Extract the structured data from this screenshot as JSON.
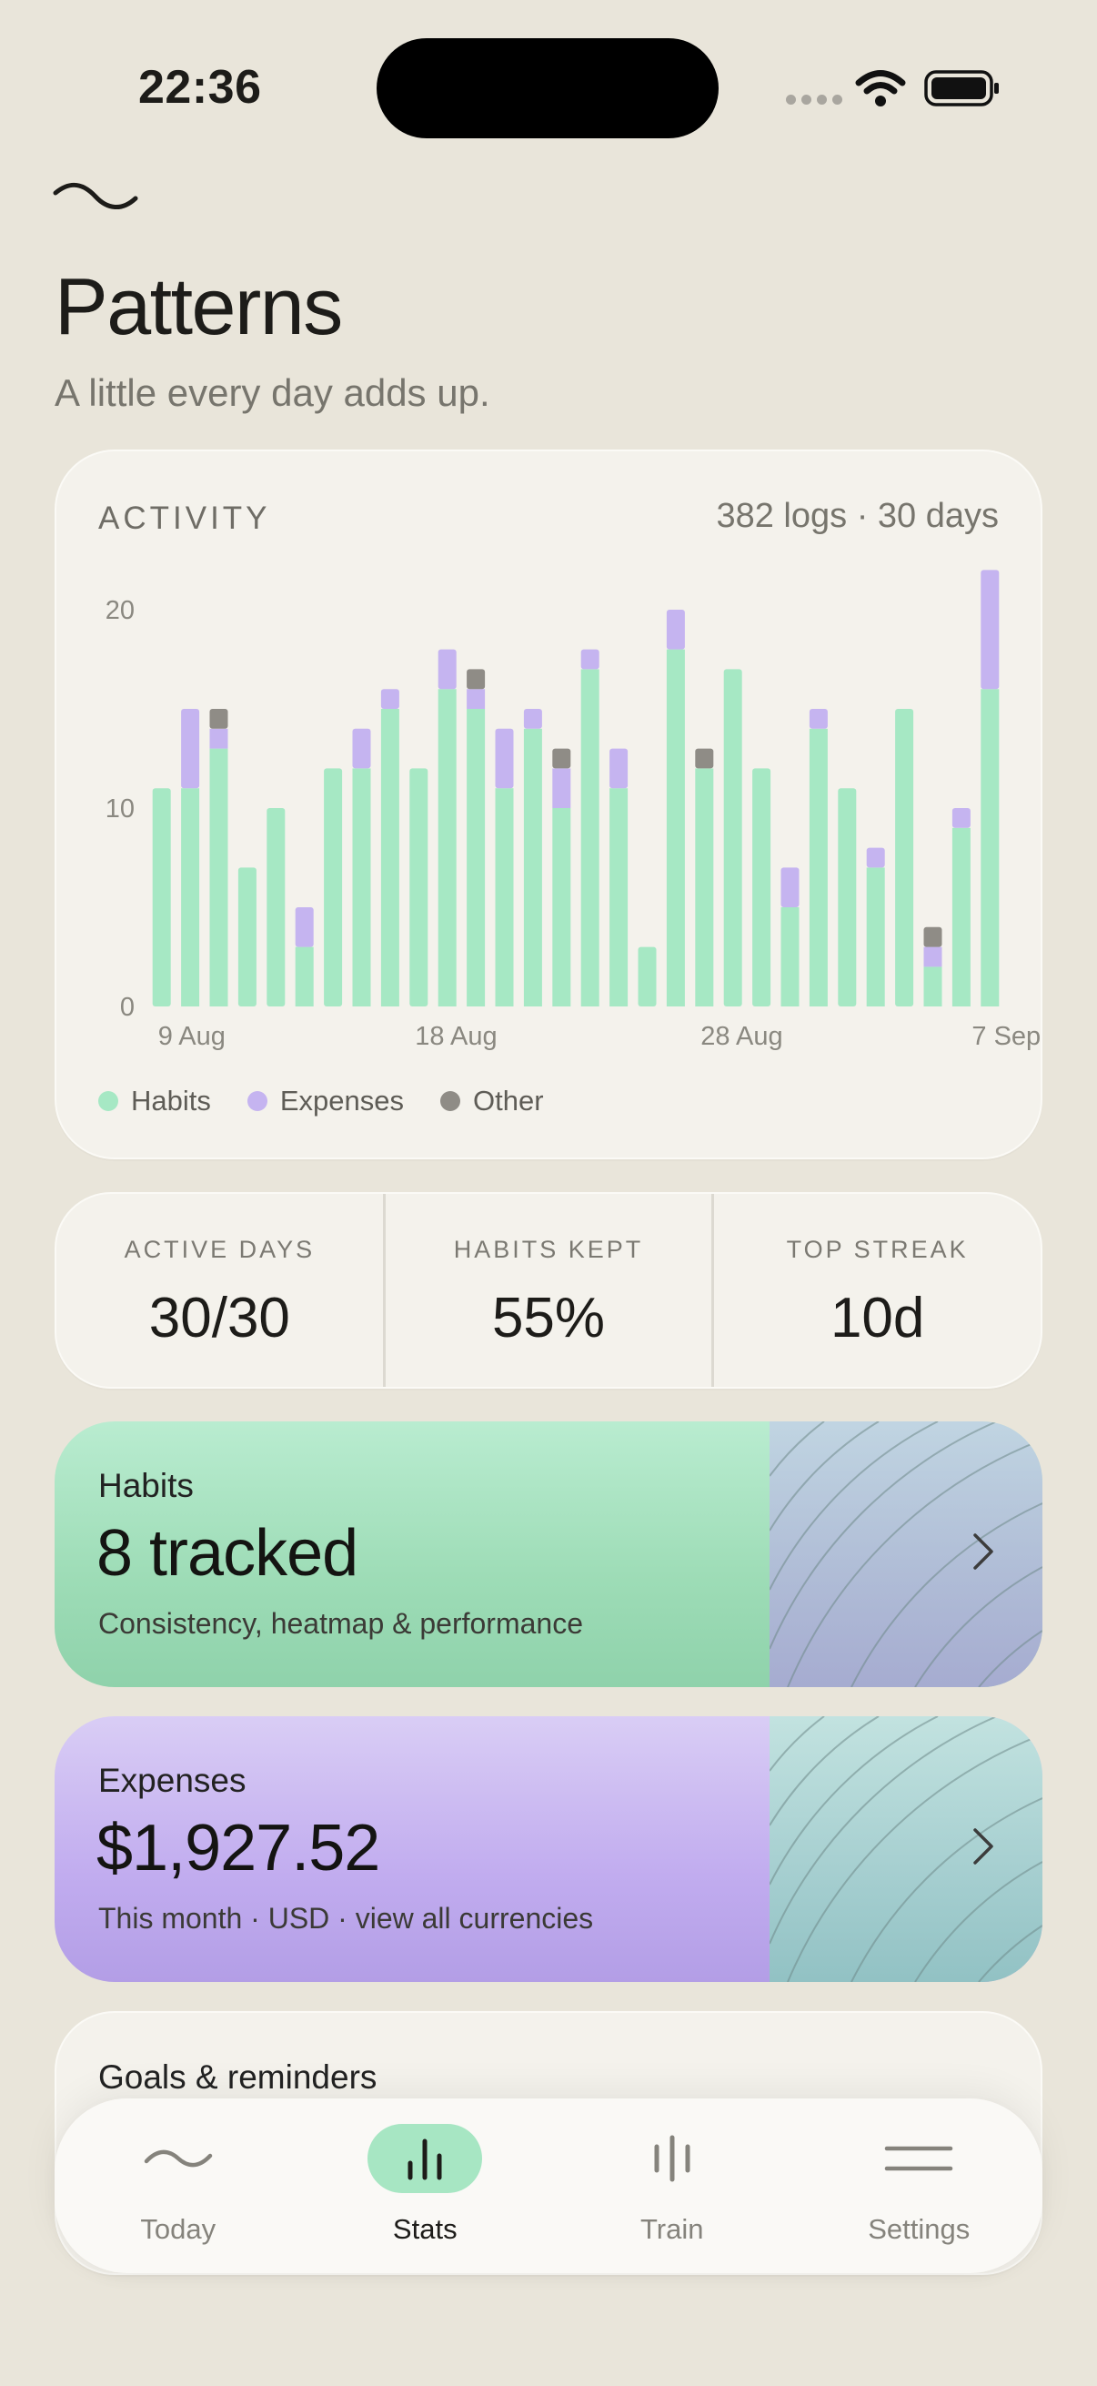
{
  "status_bar": {
    "time": "22:36"
  },
  "header": {
    "title": "Patterns",
    "subtitle": "A little every day adds up."
  },
  "activity": {
    "caption": "ACTIVITY",
    "meta": "382 logs · 30 days",
    "legend": [
      {
        "label": "Habits",
        "color": "#a6e8c4"
      },
      {
        "label": "Expenses",
        "color": "#c5b4f0"
      },
      {
        "label": "Other",
        "color": "#8f8c86"
      }
    ]
  },
  "chart_data": {
    "type": "bar",
    "stacked": true,
    "ylim": [
      0,
      22
    ],
    "y_ticks": [
      0,
      10,
      20
    ],
    "x_tick_labels": [
      {
        "index": 0,
        "label": "9 Aug"
      },
      {
        "index": 9,
        "label": "18 Aug"
      },
      {
        "index": 19,
        "label": "28 Aug"
      },
      {
        "index": 29,
        "label": "7 Sep"
      }
    ],
    "series": [
      {
        "name": "Habits",
        "color": "#a6e8c4",
        "values": [
          11,
          11,
          13,
          7,
          10,
          3,
          12,
          12,
          15,
          12,
          16,
          15,
          11,
          14,
          10,
          17,
          11,
          3,
          18,
          12,
          17,
          12,
          5,
          14,
          11,
          7,
          15,
          2,
          9,
          16
        ]
      },
      {
        "name": "Expenses",
        "color": "#c5b4f0",
        "values": [
          0,
          4,
          1,
          0,
          0,
          2,
          0,
          2,
          1,
          0,
          2,
          1,
          3,
          1,
          2,
          1,
          2,
          0,
          2,
          0,
          0,
          0,
          2,
          1,
          0,
          1,
          0,
          1,
          1,
          6
        ]
      },
      {
        "name": "Other",
        "color": "#8f8c86",
        "values": [
          0,
          0,
          1,
          0,
          0,
          0,
          0,
          0,
          0,
          0,
          0,
          1,
          0,
          0,
          1,
          0,
          0,
          0,
          0,
          1,
          0,
          0,
          0,
          0,
          0,
          0,
          0,
          1,
          0,
          0
        ]
      }
    ]
  },
  "stats": [
    {
      "label": "ACTIVE DAYS",
      "value": "30/30"
    },
    {
      "label": "HABITS KEPT",
      "value": "55%"
    },
    {
      "label": "TOP STREAK",
      "value": "10d"
    }
  ],
  "habits_card": {
    "kicker": "Habits",
    "value": "8 tracked",
    "desc": "Consistency, heatmap & performance"
  },
  "expenses_card": {
    "kicker": "Expenses",
    "value": "$1,927.52",
    "desc": "This month · USD · view all currencies"
  },
  "goals_card": {
    "title": "Goals & reminders"
  },
  "tabbar": {
    "active": "Stats",
    "items": [
      {
        "label": "Today",
        "icon": "wave-icon"
      },
      {
        "label": "Stats",
        "icon": "bar-chart-icon"
      },
      {
        "label": "Train",
        "icon": "train-bars-icon"
      },
      {
        "label": "Settings",
        "icon": "menu-lines-icon"
      }
    ]
  }
}
